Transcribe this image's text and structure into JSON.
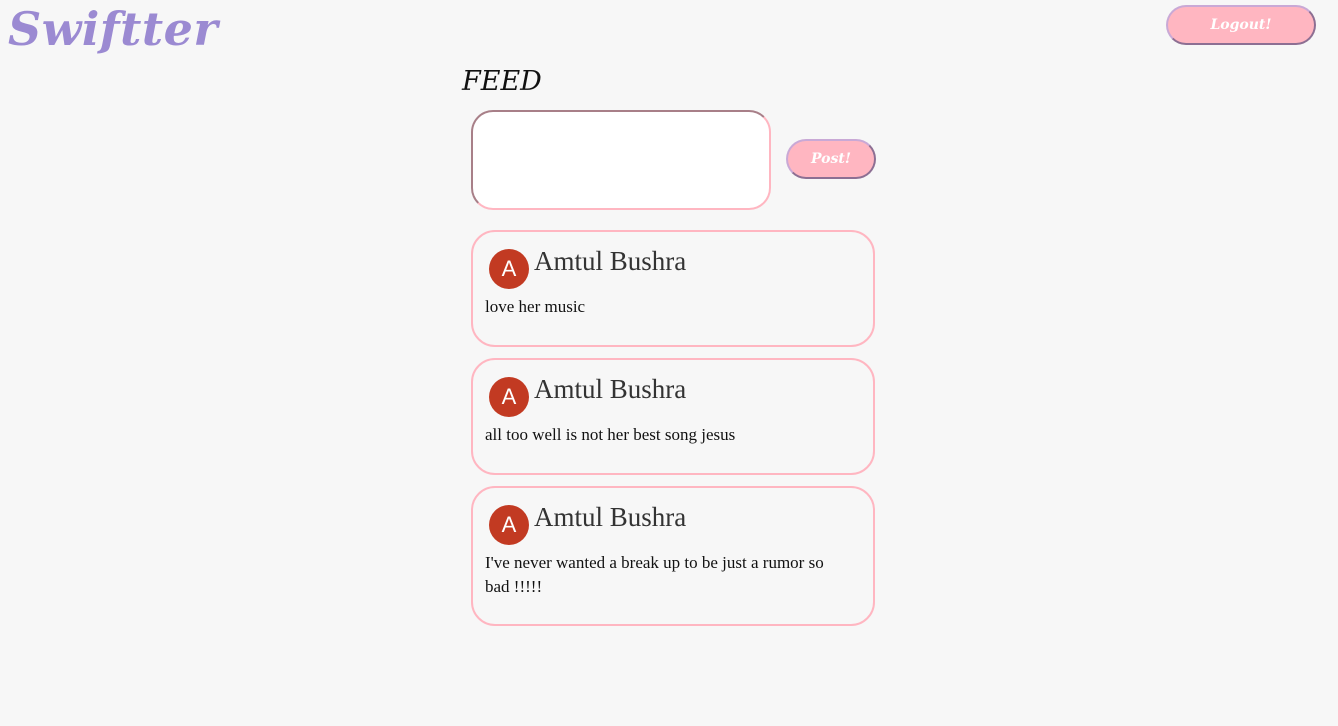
{
  "header": {
    "logo": "Swiftter",
    "logout_label": "Logout!"
  },
  "feed": {
    "title": "FEED",
    "compose_value": "",
    "post_label": "Post!"
  },
  "posts": [
    {
      "avatar_letter": "A",
      "author": "Amtul Bushra",
      "text": "love her music"
    },
    {
      "avatar_letter": "A",
      "author": "Amtul Bushra",
      "text": "all too well is not her best song jesus"
    },
    {
      "avatar_letter": "A",
      "author": "Amtul Bushra",
      "text": "I've never wanted a break up to be just a rumor so bad !!!!!"
    }
  ],
  "colors": {
    "brand": "#9b8ad2",
    "button": "#ffb6c1",
    "avatar": "#c23a22"
  }
}
